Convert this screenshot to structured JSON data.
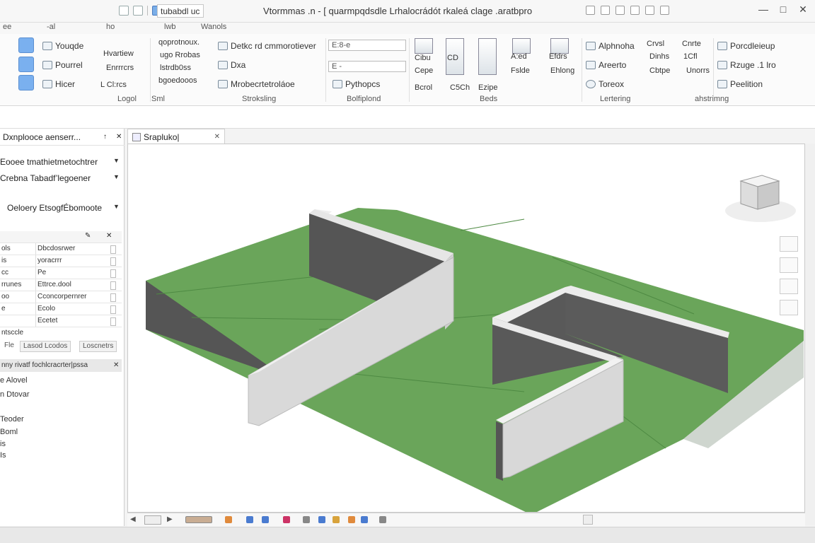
{
  "window": {
    "title": "Vtormmas .n - [ quarmpqdsdle Lrhalocrádót rkaleá clage .aratbpro",
    "document_field": "tubabdl uc"
  },
  "menu": [
    {
      "label": "ee"
    },
    {
      "label": "-al"
    },
    {
      "label": "ho"
    },
    {
      "label": "lwb"
    },
    {
      "label": "Wanols"
    }
  ],
  "ribbon": {
    "group1": {
      "items": [
        "Youqde",
        "Pourrel",
        "Hicer"
      ],
      "extra": [
        "Hvartiew",
        "Enrrrcrs",
        "L Cl:rcs"
      ],
      "label_a": "Logol",
      "label_b": "Sml"
    },
    "group2": {
      "items": [
        "qoprotnoux.",
        "ugo Rrobas",
        "lstrdb0ss",
        "bgoedooos"
      ],
      "options": [
        "Detkc rd cmmorotiever",
        "Dxa",
        "Mrobecrtetroláoe"
      ],
      "label": "Stroksling"
    },
    "group3": {
      "combo_a": "E:8-e",
      "combo_b": "E -",
      "pycleps": "Pythopcs",
      "label": "Bolfiplond"
    },
    "group4": {
      "items": [
        "Cibu",
        "Cepe",
        "Bcrol",
        "CD",
        "C5Ch",
        "Ezipe",
        "A:ed",
        "Fslde",
        "Efdrs",
        "Ehlong"
      ],
      "label": "Beds"
    },
    "group5": {
      "items": [
        "Alphnoha",
        "Areerto",
        "Toreox"
      ],
      "label": "Lertering"
    },
    "group6": {
      "items": [
        "Crvsl",
        "Dinhs",
        "Cbtpe",
        "Cnrte",
        "1Cfl",
        "Unorrs"
      ],
      "label": "ahstrimng"
    },
    "group7": {
      "items": [
        "Porcdleieup",
        "Rzuge .1 lro",
        "Peelition"
      ]
    }
  },
  "left_panel": {
    "header": "Dxnplooce aenserr...",
    "rows": [
      "Eooee tmathietmetochtrer",
      "Crebna Tabadf’legoener",
      "Oeloery EtsogfÉbomoote"
    ],
    "props": [
      {
        "k": "ols",
        "v": "Dbcdosrwer"
      },
      {
        "k": "is",
        "v": "yoracrrr"
      },
      {
        "k": "cc",
        "v": "Pe"
      },
      {
        "k": "rrunes",
        "v": "Ettrce.dool"
      },
      {
        "k": "oo",
        "v": "Cconcorpernrer"
      },
      {
        "k": "e",
        "v": "Ecolo"
      },
      {
        "k": "",
        "v": "Ecetet"
      }
    ],
    "props_footer": "ntsccle",
    "buttons": [
      "Fle",
      "Lasod Lcodos",
      "Loscnetrs"
    ],
    "subheader": "nny rivatf fochlcracrter|pssa",
    "list": [
      "e Alovel",
      "n Dtovar",
      "Teoder",
      "Boml",
      "is",
      "Is"
    ]
  },
  "view": {
    "tab_label": "Srapluko|"
  },
  "colors": {
    "ribbon_blue": "#7ab0ef",
    "terrain_green": "#6aa55a",
    "wall_light": "#dcdcdc",
    "wall_dark": "#555555"
  }
}
